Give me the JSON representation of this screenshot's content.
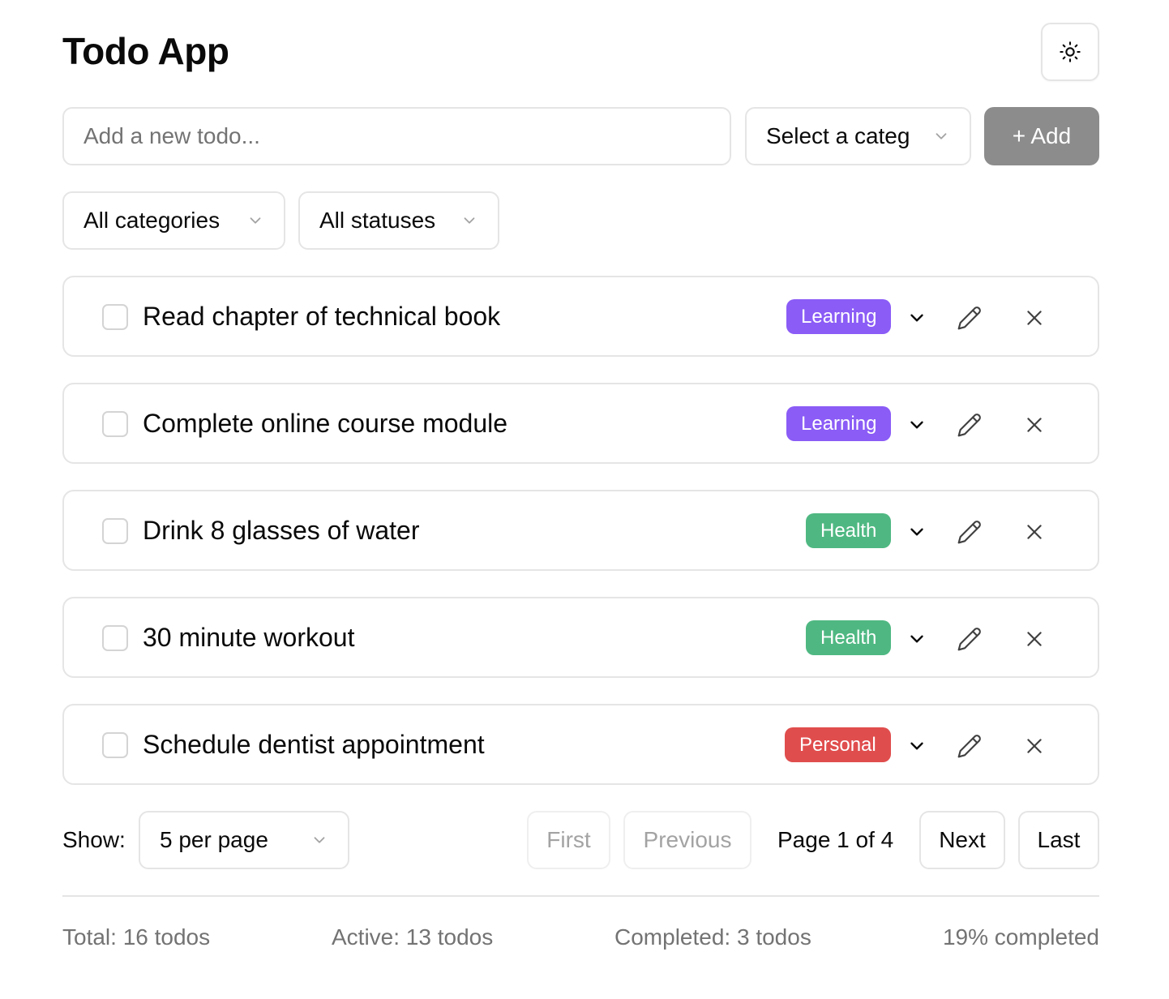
{
  "header": {
    "title": "Todo App",
    "theme_icon": "sun-icon"
  },
  "add_form": {
    "placeholder": "Add a new todo...",
    "category_select": "Select a categ",
    "add_label": "+ Add"
  },
  "filters": {
    "category": "All categories",
    "status": "All statuses"
  },
  "todos": [
    {
      "text": "Read chapter of technical book",
      "category": "Learning"
    },
    {
      "text": "Complete online course module",
      "category": "Learning"
    },
    {
      "text": "Drink 8 glasses of water",
      "category": "Health"
    },
    {
      "text": "30 minute workout",
      "category": "Health"
    },
    {
      "text": "Schedule dentist appointment",
      "category": "Personal"
    }
  ],
  "category_colors": {
    "Learning": "#8b5cf6",
    "Health": "#4fb882",
    "Personal": "#e04d4d"
  },
  "pagination": {
    "show_label": "Show:",
    "per_page": "5 per page",
    "first": "First",
    "previous": "Previous",
    "page_info": "Page 1 of 4",
    "next": "Next",
    "last": "Last"
  },
  "stats": {
    "total": "Total: 16 todos",
    "active": "Active: 13 todos",
    "completed": "Completed: 3 todos",
    "percent": "19% completed"
  }
}
